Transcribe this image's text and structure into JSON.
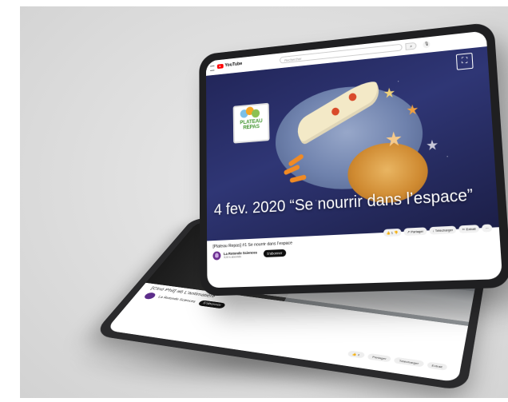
{
  "front_tablet": {
    "youtube_logo_text": "YouTube",
    "search_placeholder": "Rechercher",
    "overlay_text": "4 fev. 2020 “Se nourrir dans l’espace”",
    "thumbnail_logo": {
      "line1": "PLATEAU",
      "line2": "REPAS"
    },
    "video_title": "[Plateau Repas] #1 Se nourrir dans l’espace",
    "channel_name": "La Rotonde Sciences",
    "subscribers": "3,02 k abonnés",
    "subscribe_label": "S'abonner",
    "like_count": "1",
    "share_label": "Partager",
    "download_label": "Télécharger",
    "clip_label": "Extrait",
    "more_label": "···"
  },
  "back_tablet": {
    "video_title": "[Ciné Phil] #6 L’antimatière",
    "channel_name": "La Rotonde Sciences",
    "subscribe_label": "S'abonner",
    "like_count": "1",
    "share_label": "Partager",
    "download_label": "Télécharger",
    "clip_label": "Extrait"
  },
  "colors": {
    "youtube_red": "#ff0000",
    "background": "#dcdcdc",
    "tablet_frame": "#1f1f21",
    "video_bg": "#2f3675"
  }
}
